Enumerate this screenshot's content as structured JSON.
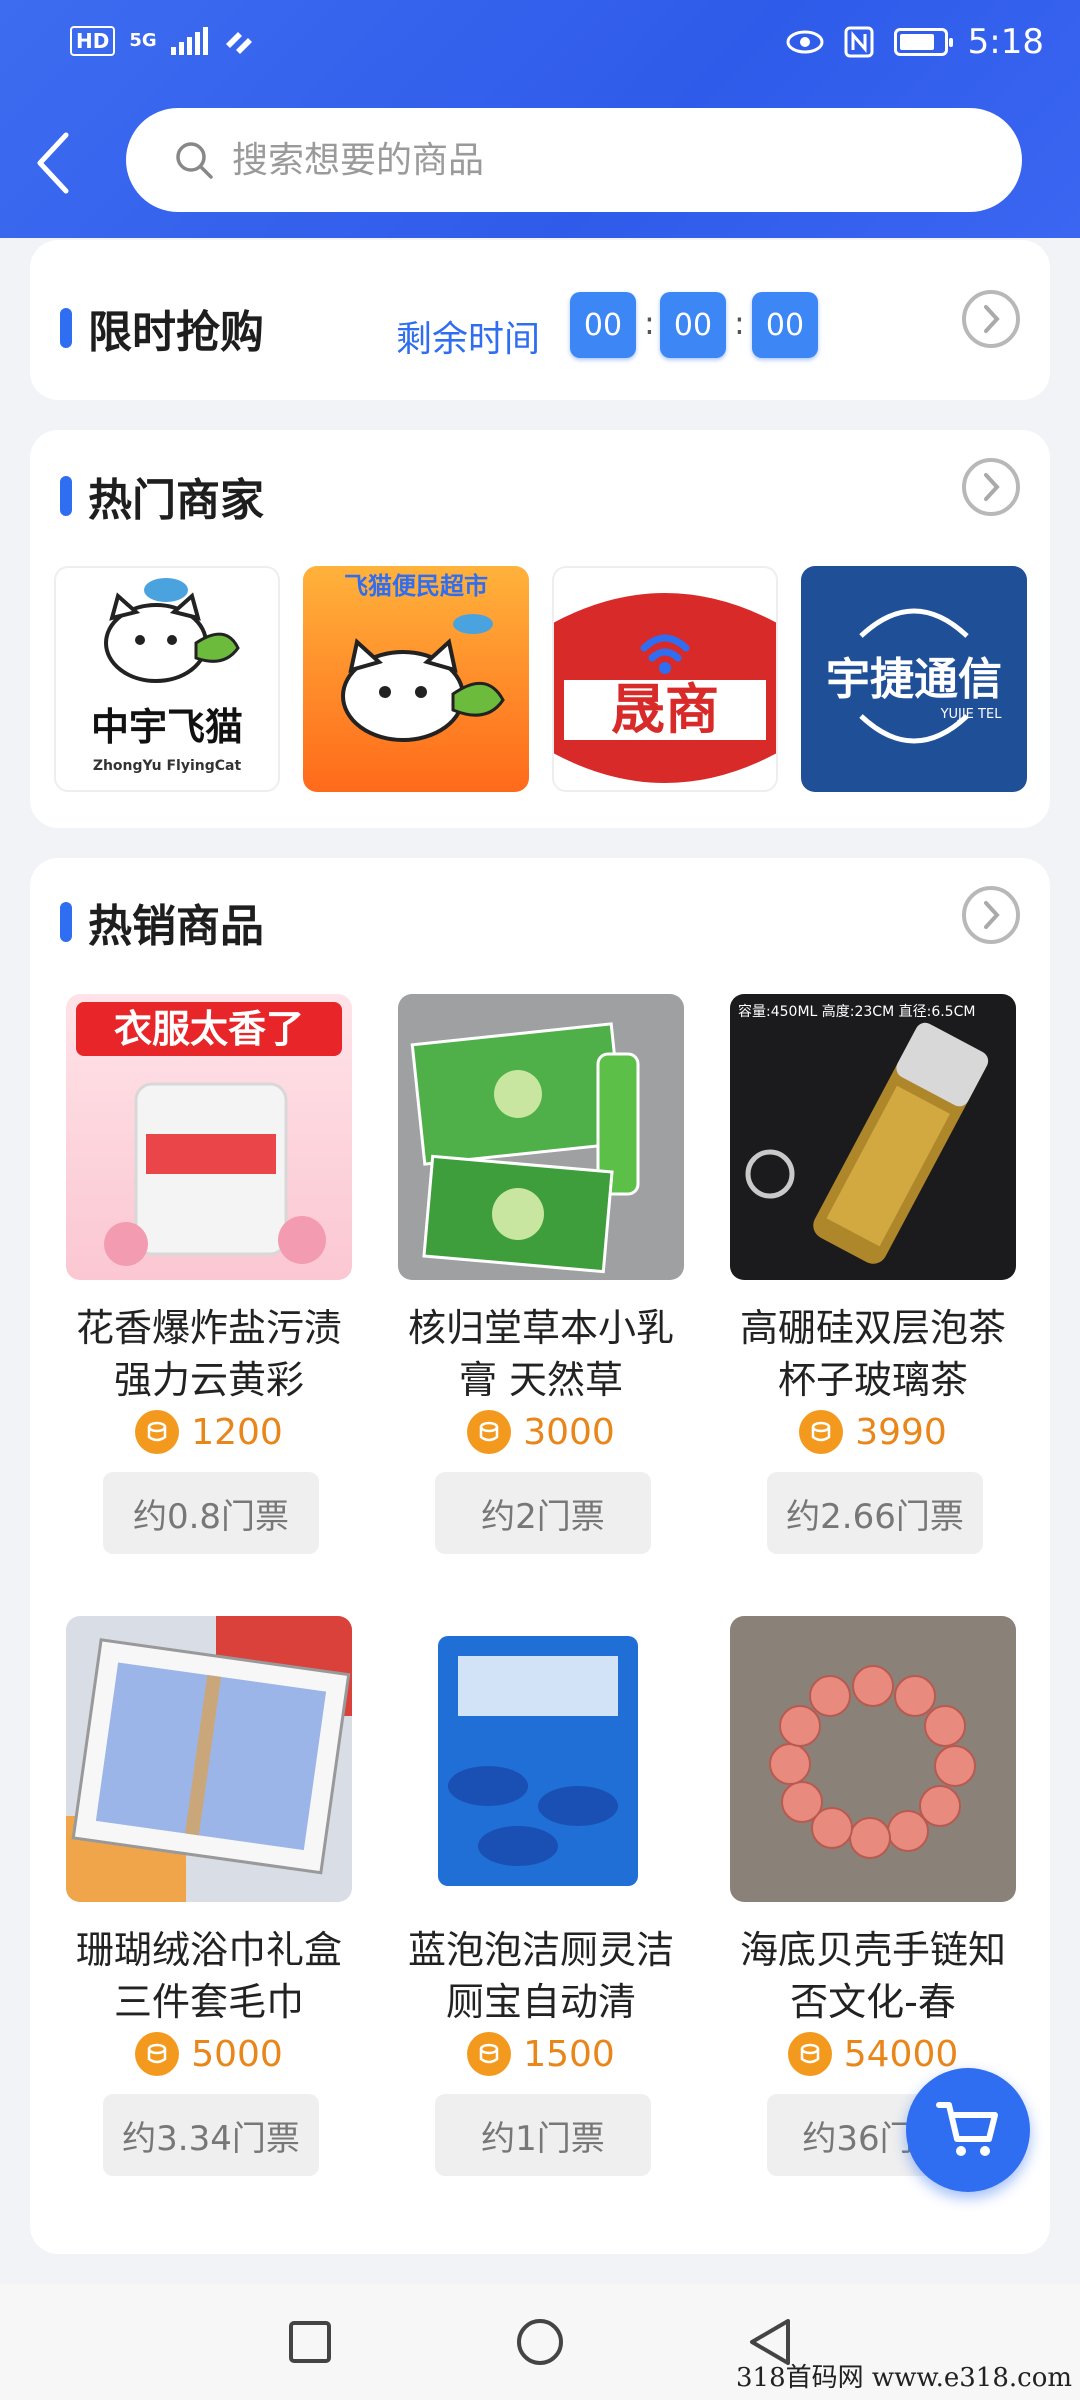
{
  "status_bar": {
    "hd": "HD",
    "network": "5G",
    "time": "5:18"
  },
  "search": {
    "placeholder": "搜索想要的商品"
  },
  "flash_sale": {
    "title": "限时抢购",
    "countdown_label": "剩余时间",
    "hours": "00",
    "minutes": "00",
    "seconds": "00",
    "separator": ":"
  },
  "hot_merchants": {
    "title": "热门商家",
    "items": [
      {
        "name": "中宇飞猫",
        "subtitle": "ZhongYu FlyingCat"
      },
      {
        "name": "飞猫便民超市"
      },
      {
        "name": "晟商"
      },
      {
        "name": "宇捷通信",
        "subtitle": "YUJIE TEL"
      }
    ]
  },
  "hot_products": {
    "title": "热销商品",
    "items": [
      {
        "name": "花香爆炸盐污渍强力云黄彩",
        "price": "1200",
        "ticket": "约0.8门票",
        "image_text": "衣服太香了"
      },
      {
        "name": "核归堂草本小乳膏  天然草",
        "price": "3000",
        "ticket": "约2门票"
      },
      {
        "name": "高硼硅双层泡茶杯子玻璃茶",
        "price": "3990",
        "ticket": "约2.66门票",
        "image_text": "容量:450ML 高度:23CM 直径:6.5CM"
      },
      {
        "name": "珊瑚绒浴巾礼盒三件套毛巾",
        "price": "5000",
        "ticket": "约3.34门票"
      },
      {
        "name": "蓝泡泡洁厕灵洁厕宝自动清",
        "price": "1500",
        "ticket": "约1门票"
      },
      {
        "name": "海底贝壳手链知否文化-春",
        "price": "54000",
        "ticket": "约36门票"
      }
    ]
  },
  "watermark": "318首码网  www.e318.com",
  "colors": {
    "primary": "#2f6ef0",
    "price": "#e9861a",
    "header": "#3d6cf0"
  }
}
